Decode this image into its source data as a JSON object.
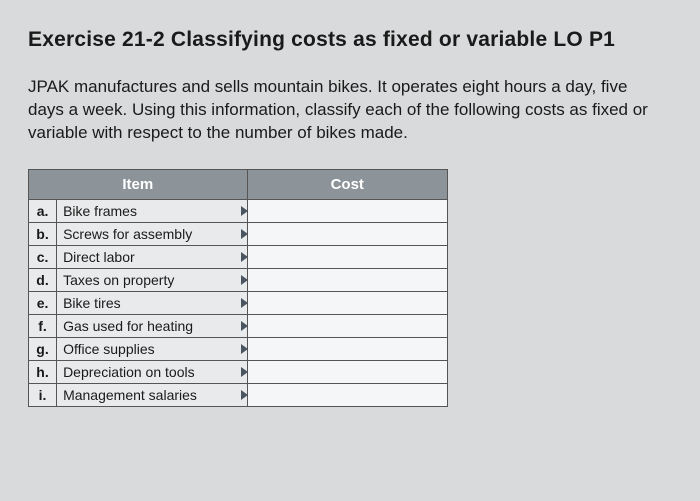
{
  "title": "Exercise 21-2 Classifying costs as fixed or variable LO P1",
  "instructions": "JPAK manufactures and sells mountain bikes. It operates eight hours a day, five days a week. Using this information, classify each of the following costs as fixed or variable with respect to the number of bikes made.",
  "table": {
    "headers": {
      "item": "Item",
      "cost": "Cost"
    },
    "rows": [
      {
        "letter": "a.",
        "item": "Bike frames",
        "cost": ""
      },
      {
        "letter": "b.",
        "item": "Screws for assembly",
        "cost": ""
      },
      {
        "letter": "c.",
        "item": "Direct labor",
        "cost": ""
      },
      {
        "letter": "d.",
        "item": "Taxes on property",
        "cost": ""
      },
      {
        "letter": "e.",
        "item": "Bike tires",
        "cost": ""
      },
      {
        "letter": "f.",
        "item": "Gas used for heating",
        "cost": ""
      },
      {
        "letter": "g.",
        "item": "Office supplies",
        "cost": ""
      },
      {
        "letter": "h.",
        "item": "Depreciation on tools",
        "cost": ""
      },
      {
        "letter": "i.",
        "item": "Management salaries",
        "cost": ""
      }
    ]
  }
}
